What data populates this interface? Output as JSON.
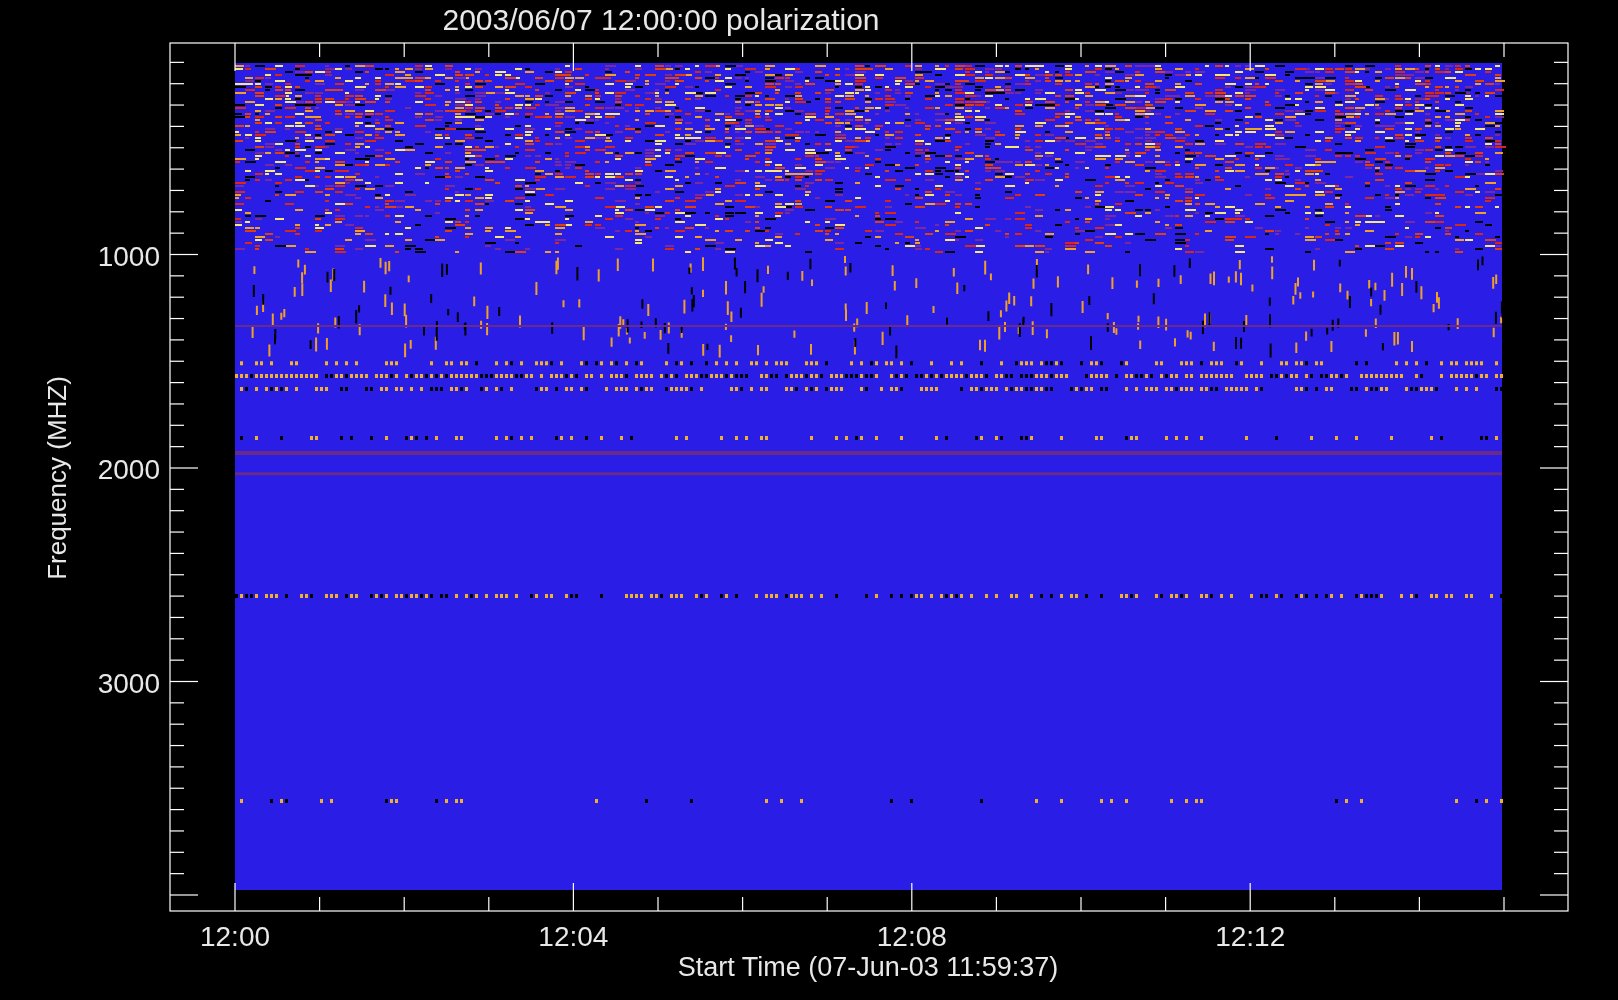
{
  "title": "2003/06/07 12:00:00 polarization",
  "y_axis": {
    "label": "Frequency (MHZ)",
    "ticks": [
      "1000",
      "2000",
      "3000"
    ]
  },
  "x_axis": {
    "label": "Start Time (07-Jun-03 11:59:37)",
    "ticks": [
      "12:00",
      "12:04",
      "12:08",
      "12:12"
    ]
  }
}
